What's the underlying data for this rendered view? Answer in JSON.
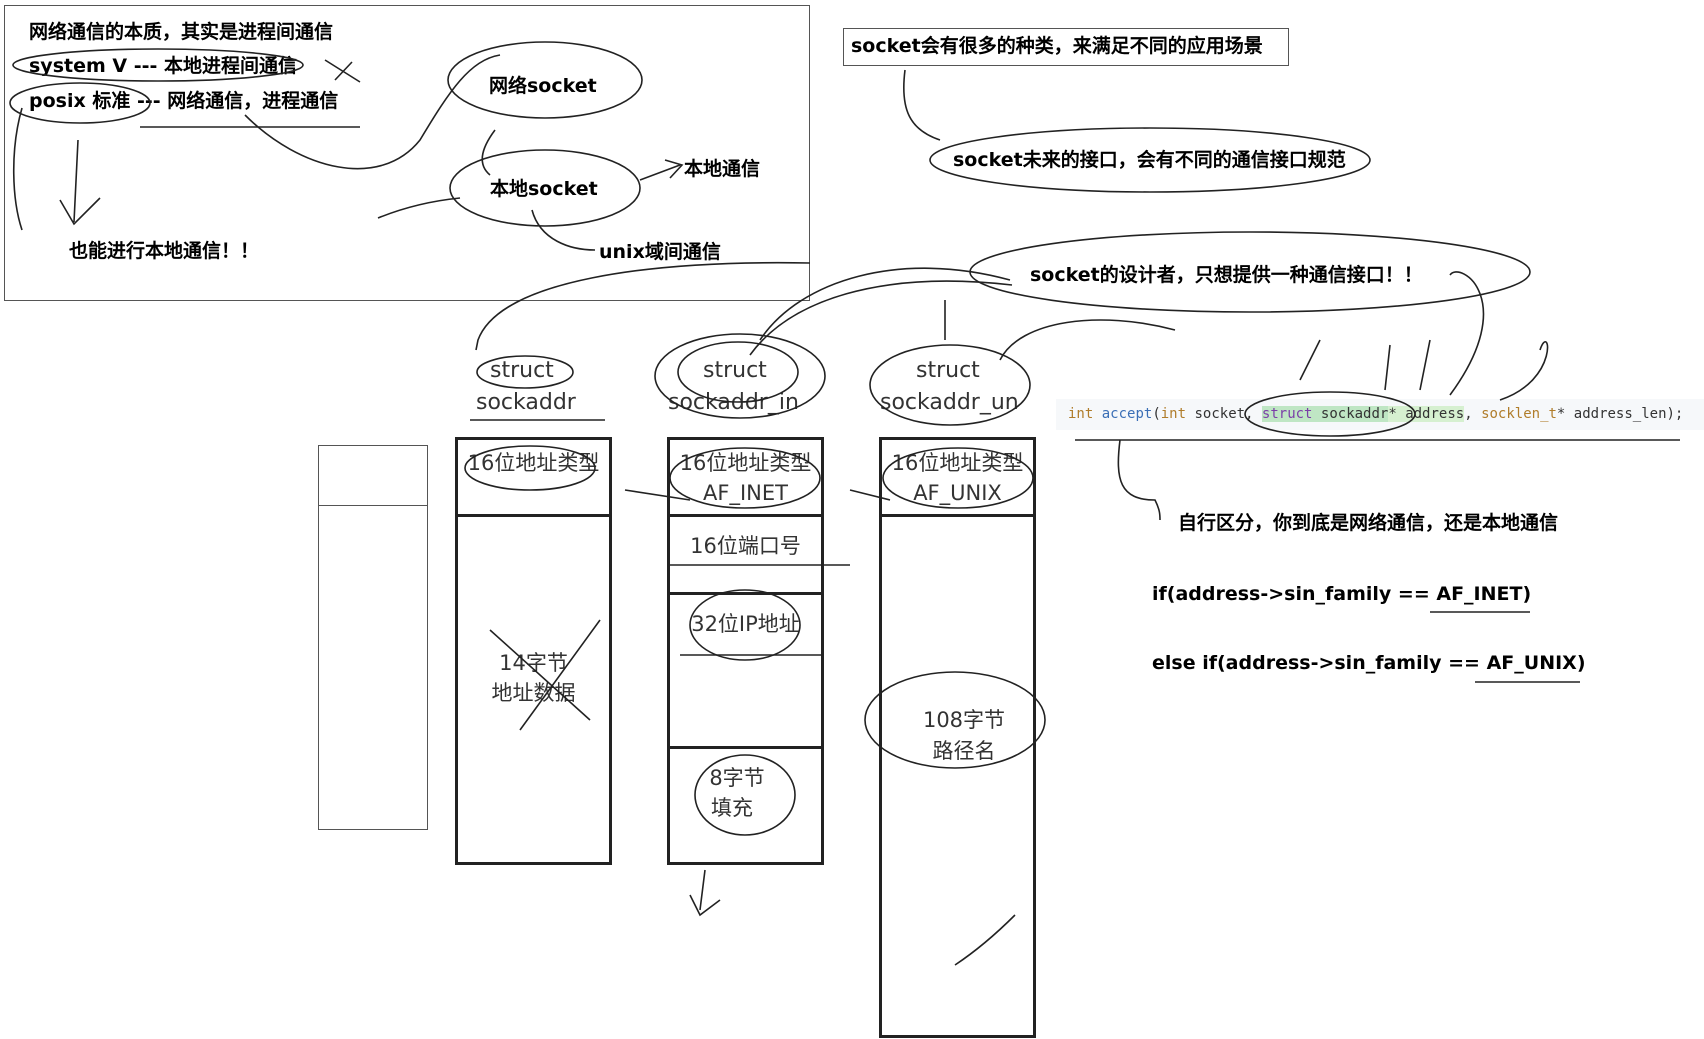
{
  "top_left": {
    "line1": "网络通信的本质，其实是进程间通信",
    "line2": "system V --- 本地进程间通信",
    "line3": "posix 标准 --- 网络通信，进程通信",
    "line4": "也能进行本地通信！！",
    "net_socket": "网络socket",
    "local_socket": "本地socket",
    "local_comm": "本地通信",
    "unix_comm": "unix域间通信"
  },
  "notes": {
    "kinds": "socket会有很多的种类，来满足不同的应用场景",
    "future": "socket未来的接口，会有不同的通信接口规范",
    "designer": "socket的设计者，只想提供一种通信接口！！",
    "distinguish": "自行区分，你到底是网络通信，还是本地通信",
    "if_inet": "if(address->sin_family  == AF_INET)",
    "if_unix": "else if(address->sin_family  == AF_UNIX)"
  },
  "code": {
    "t1": "int",
    "t2": "accept",
    "t3": "(",
    "t4": "int",
    "t5": " socket, ",
    "t6": "struct",
    "t7": " sockaddr",
    "t8": "* address",
    "t9": ", ",
    "t10": "socklen_t",
    "t11": "* address_len);"
  },
  "structs": {
    "sockaddr": {
      "title1": "struct",
      "title2": "sockaddr",
      "f1": "16位地址类型",
      "f2a": "14字节",
      "f2b": "地址数据"
    },
    "sockaddr_in": {
      "title1": "struct",
      "title2": "sockaddr_in",
      "f1a": "16位地址类型",
      "f1b": "AF_INET",
      "f2": "16位端口号",
      "f3": "32位IP地址",
      "f4a": "8字节",
      "f4b": "填充"
    },
    "sockaddr_un": {
      "title1": "struct",
      "title2": "sockaddr_un",
      "f1a": "16位地址类型",
      "f1b": "AF_UNIX",
      "f2a": "108字节",
      "f2b": "路径名"
    }
  }
}
